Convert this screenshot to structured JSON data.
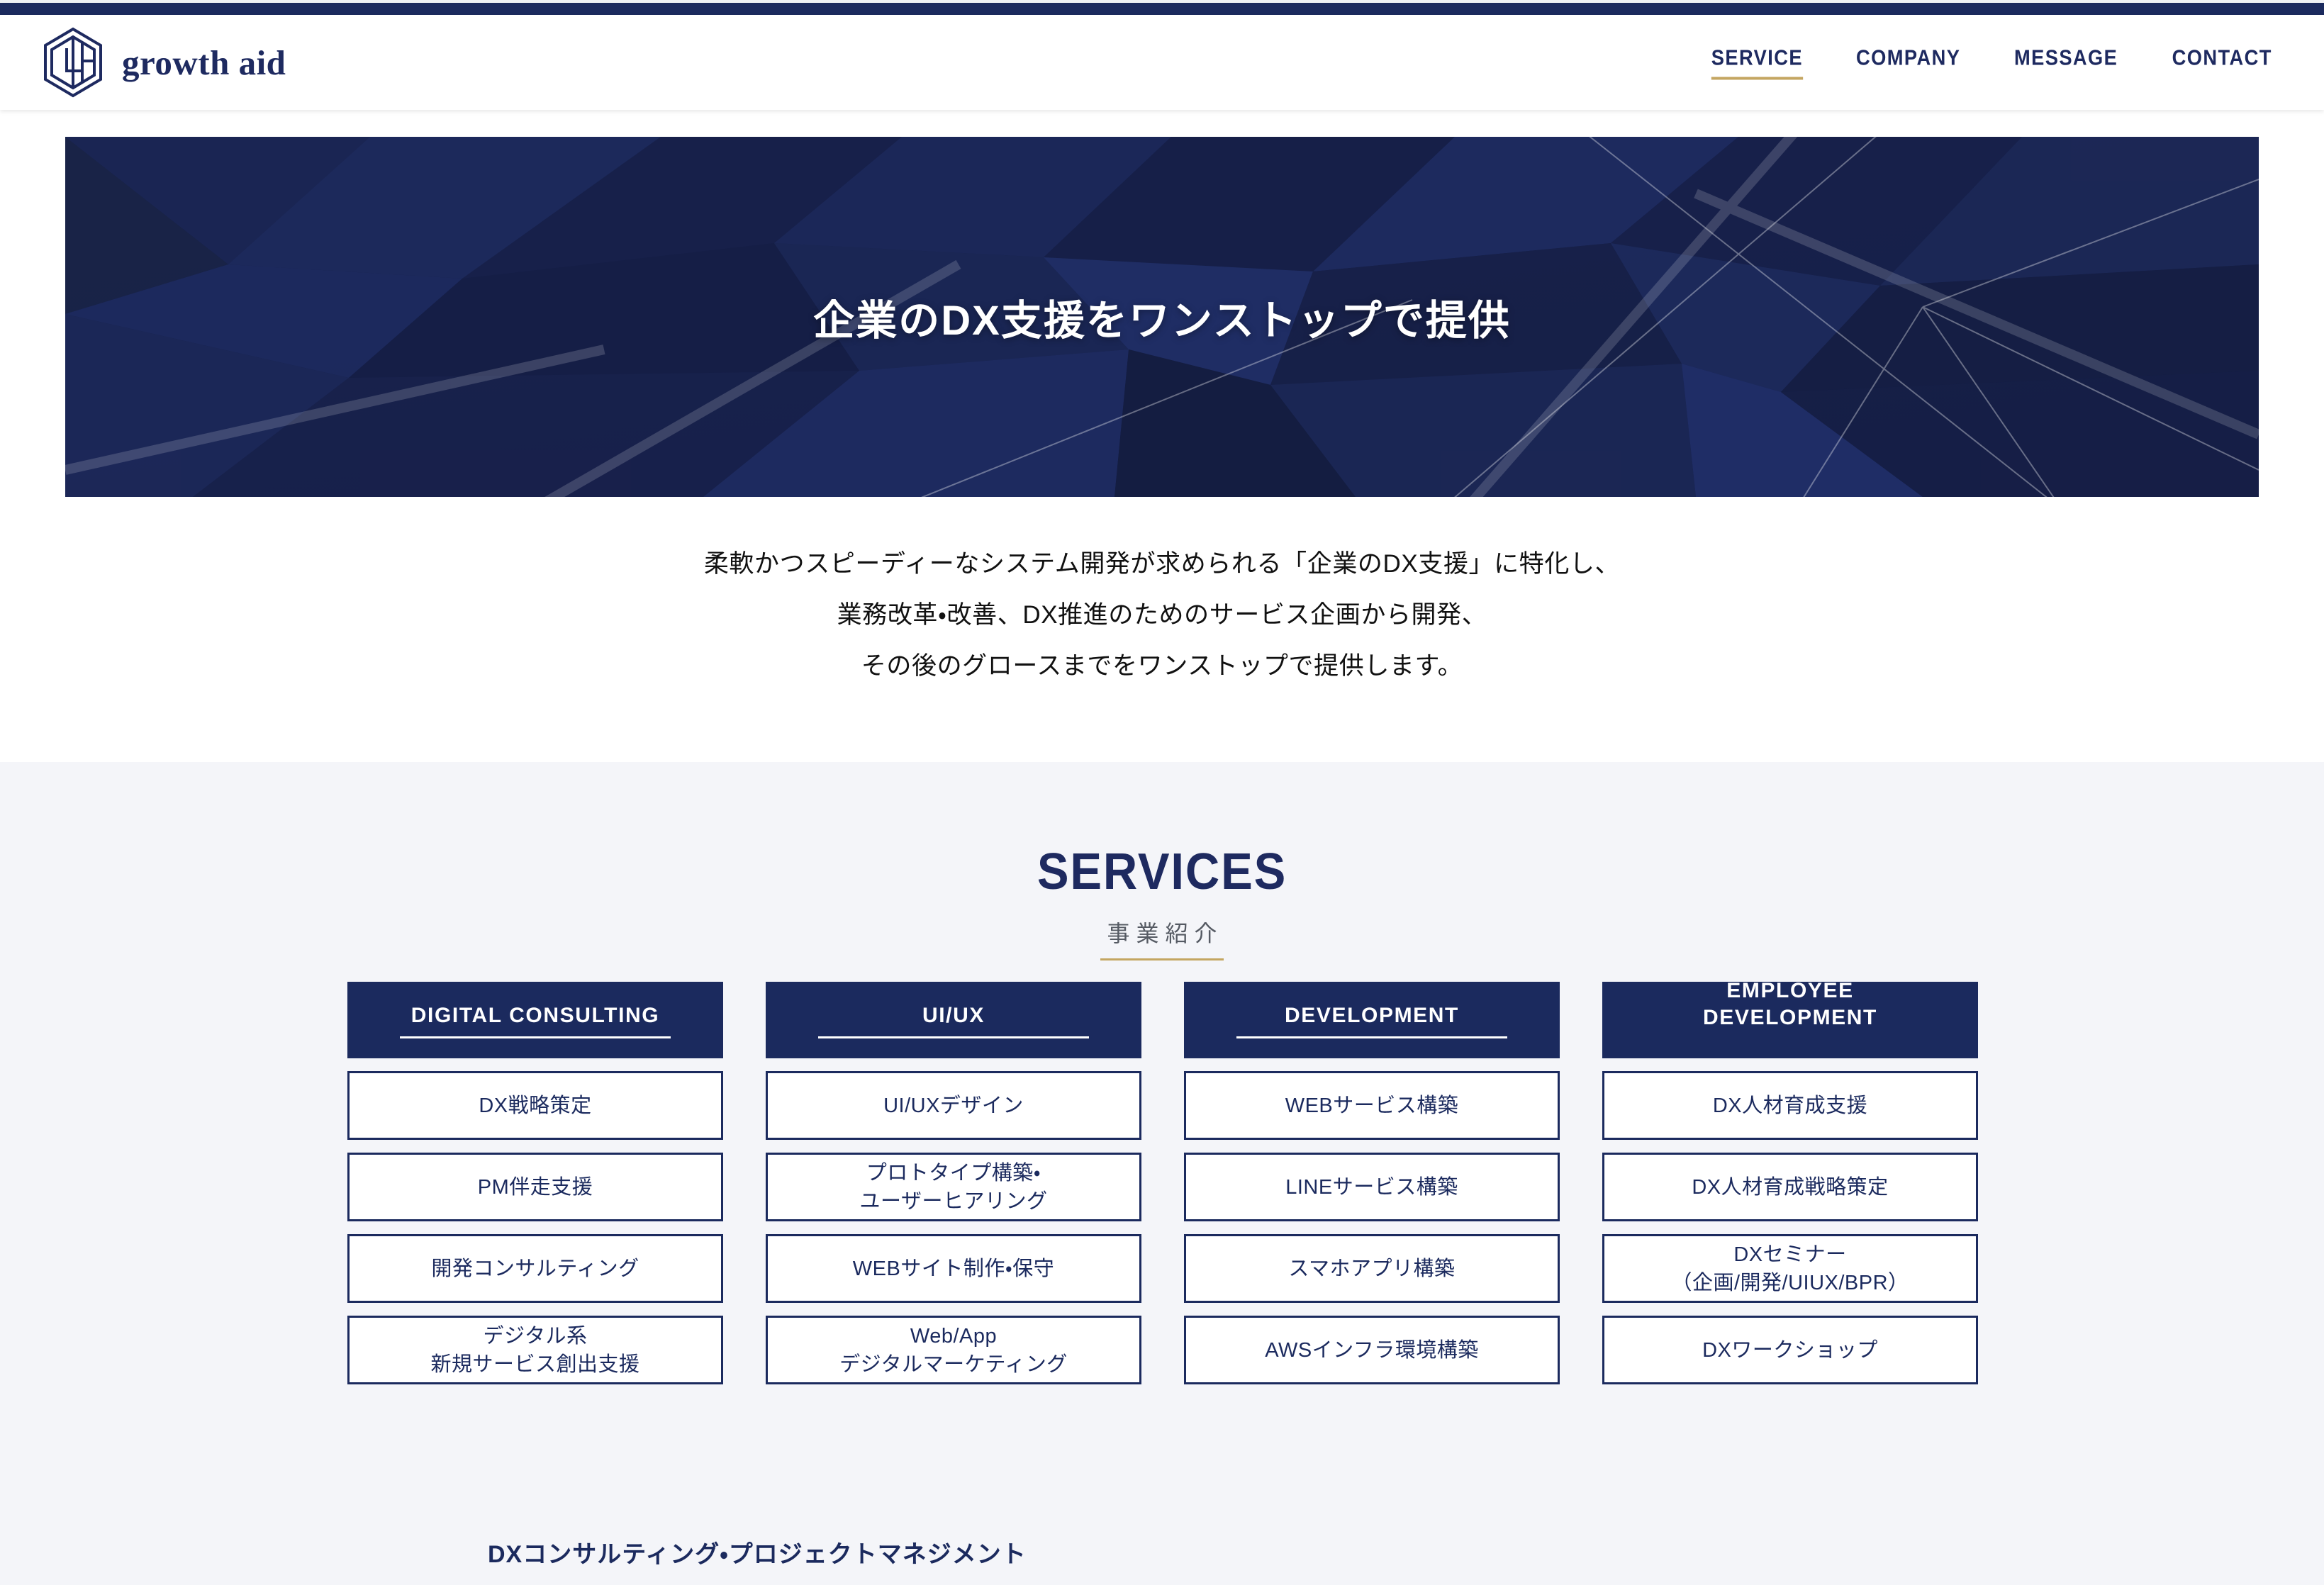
{
  "brand": {
    "name": "growth aid",
    "logo_icon": "hexagon-ga-monogram-icon"
  },
  "nav": {
    "items": [
      {
        "label": "SERVICE",
        "active": true
      },
      {
        "label": "COMPANY",
        "active": false
      },
      {
        "label": "MESSAGE",
        "active": false
      },
      {
        "label": "CONTACT",
        "active": false
      }
    ],
    "active_underline_color": "#c4a661"
  },
  "hero": {
    "title": "企業のDX支援をワンストップで提供",
    "background_color": "#16214b",
    "accent_line_color": "#ffffff"
  },
  "intro": {
    "line1": "柔軟かつスピーディーなシステム開発が求められる「企業のDX支援」に特化し、",
    "line2": "業務改革・改善、DX推進のためのサービス企画から開発、",
    "line3": "その後のグロースまでをワンストップで提供します。"
  },
  "services": {
    "section_title": "SERVICES",
    "section_subtitle": "事業紹介",
    "subtitle_rule_color": "#c4a661",
    "background_color": "#f4f5f9",
    "header_color": "#1b2a5e",
    "columns": [
      {
        "header": "DIGITAL CONSULTING",
        "items": [
          "DX戦略策定",
          "PM伴走支援",
          "開発コンサルティング",
          "デジタル系\n新規サービス創出支援"
        ]
      },
      {
        "header": "UI/UX",
        "items": [
          "UI/UXデザイン",
          "プロトタイプ構築・\nユーザーヒアリング",
          "WEBサイト制作・保守",
          "Web/App\nデジタルマーケティング"
        ]
      },
      {
        "header": "DEVELOPMENT",
        "items": [
          "WEBサービス構築",
          "LINEサービス構築",
          "スマホアプリ構築",
          "AWSインフラ環境構築"
        ]
      },
      {
        "header": "EMPLOYEE\nDEVELOPMENT",
        "items": [
          "DX人材育成支援",
          "DX人材育成戦略策定",
          "DXセミナー\n（企画/開発/UIUX/BPR）",
          "DXワークショップ"
        ]
      }
    ],
    "sub_heading": "DXコンサルティング・プロジェクトマネジメント"
  }
}
